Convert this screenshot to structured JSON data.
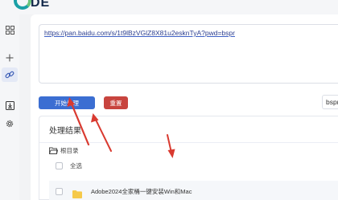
{
  "app": {
    "logo_text": "DE",
    "colors": {
      "brand_teal": "#1aa0a6",
      "brand_green": "#6cc57c",
      "primary": "#3b6ed2",
      "danger": "#c8443e",
      "arrow": "#d93a30",
      "folder": "#f5c94a"
    }
  },
  "sidebar": {
    "items": [
      {
        "icon": "grid-icon"
      },
      {
        "icon": "plus-icon"
      },
      {
        "icon": "link-icon",
        "active": true
      },
      {
        "icon": "download-box-icon"
      },
      {
        "icon": "gear-icon"
      }
    ]
  },
  "link_input": {
    "value_prefix": "https://pan.baidu.com/s/",
    "value_rest": "1t9lBzVGlZ8X81u2esknTyA?pwd=bspr"
  },
  "actions": {
    "start_label": "开始处理",
    "reset_label": "重置"
  },
  "password_input": {
    "value": "bspr"
  },
  "results": {
    "title": "处理结果",
    "root_label": "根目录",
    "select_all_label": "全选",
    "files": [
      {
        "name": "Adobe2024全家桶一键安装Win和Mac",
        "type": "folder"
      }
    ]
  }
}
